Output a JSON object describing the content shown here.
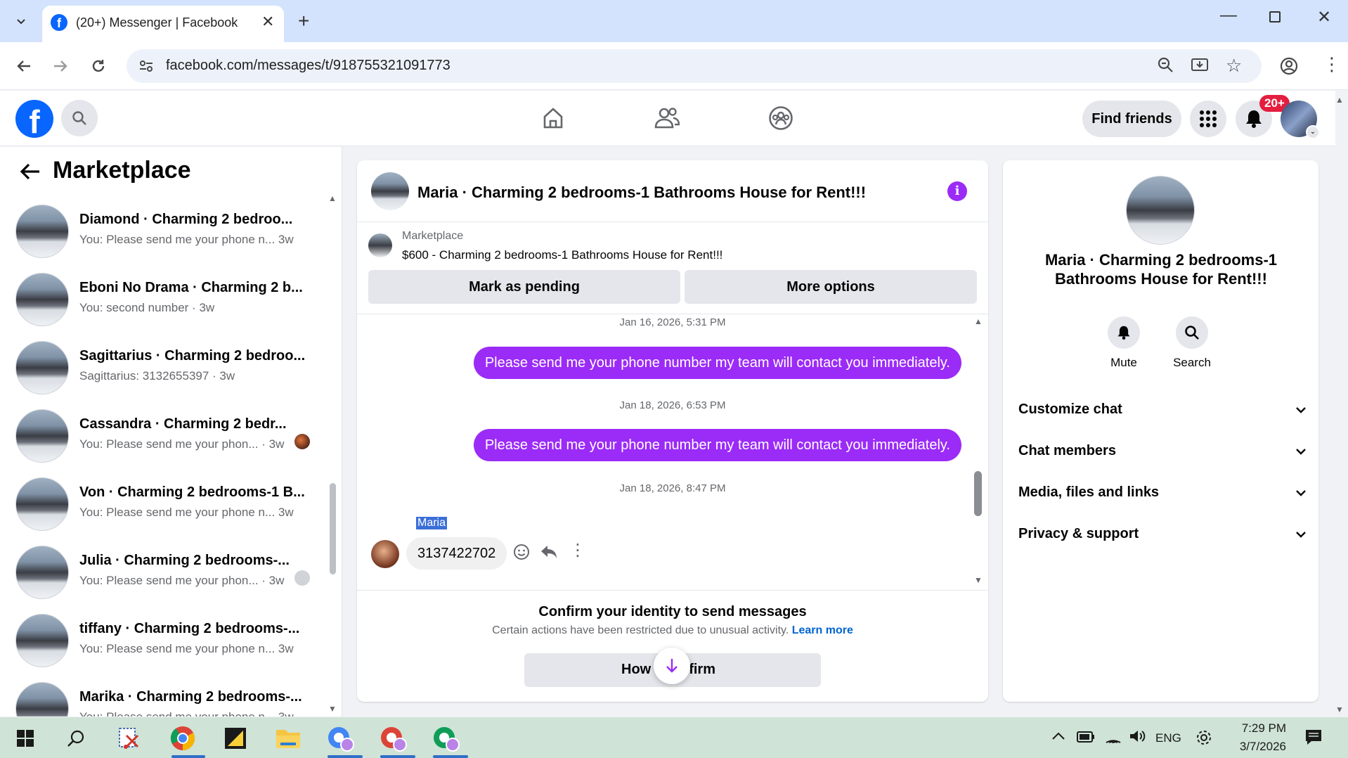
{
  "browser": {
    "tab_title": "(20+) Messenger | Facebook",
    "url": "facebook.com/messages/t/918755321091773"
  },
  "fb_header": {
    "find_friends_label": "Find friends",
    "notification_badge": "20+"
  },
  "left": {
    "title": "Marketplace",
    "conversations": [
      {
        "name": "Diamond · Charming 2 bedroo...",
        "preview": "You: Please send me your phone n...",
        "time": "3w"
      },
      {
        "name": "Eboni No Drama · Charming 2 b...",
        "preview": "You: second number",
        "time": "3w"
      },
      {
        "name": "Sagittarius · Charming 2 bedroo...",
        "preview": "Sagittarius: 3132655397",
        "time": "3w"
      },
      {
        "name": "Cassandra · Charming 2 bedr...",
        "preview": "You: Please send me your phon...",
        "time": "3w"
      },
      {
        "name": "Von · Charming 2 bedrooms-1 B...",
        "preview": "You: Please send me your phone n...",
        "time": "3w"
      },
      {
        "name": "Julia · Charming 2 bedrooms-...",
        "preview": "You: Please send me your phon...",
        "time": "3w"
      },
      {
        "name": "tiffany · Charming 2 bedrooms-...",
        "preview": "You: Please send me your phone n...",
        "time": "3w"
      },
      {
        "name": "Marika · Charming 2 bedrooms-...",
        "preview": "You: Please send me your phone n...",
        "time": "3w"
      }
    ]
  },
  "chat": {
    "title": "Maria · Charming 2 bedrooms-1 Bathrooms House for Rent!!!",
    "listing_source": "Marketplace",
    "listing_title": "$600 - Charming 2 bedrooms-1 Bathrooms House for Rent!!!",
    "mark_pending_label": "Mark as pending",
    "more_options_label": "More options",
    "ts1": "Jan 16, 2026, 5:31 PM",
    "msg1": "Please send me your phone number my team will contact you immediately.",
    "ts2": "Jan 18, 2026, 6:53 PM",
    "msg2": "Please send me your phone number my team will contact you immediately.",
    "ts3": "Jan 18, 2026, 8:47 PM",
    "sender_name": "Maria",
    "incoming_msg": "3137422702",
    "confirm_title": "Confirm your identity to send messages",
    "confirm_text": "Certain actions have been restricted due to unusual activity.",
    "learn_more": "Learn more",
    "how_confirm_left": "How",
    "how_confirm_right": "nfirm"
  },
  "details": {
    "title": "Maria · Charming 2 bedrooms-1 Bathrooms House for Rent!!!",
    "mute_label": "Mute",
    "search_label": "Search",
    "items": [
      "Customize chat",
      "Chat members",
      "Media, files and links",
      "Privacy & support"
    ]
  },
  "taskbar": {
    "language": "ENG",
    "time": "7:29 PM",
    "date": "3/7/2026"
  },
  "colors": {
    "accent_purple": "#9b2bf7",
    "fb_blue": "#0866ff",
    "link_blue": "#0064d1"
  }
}
